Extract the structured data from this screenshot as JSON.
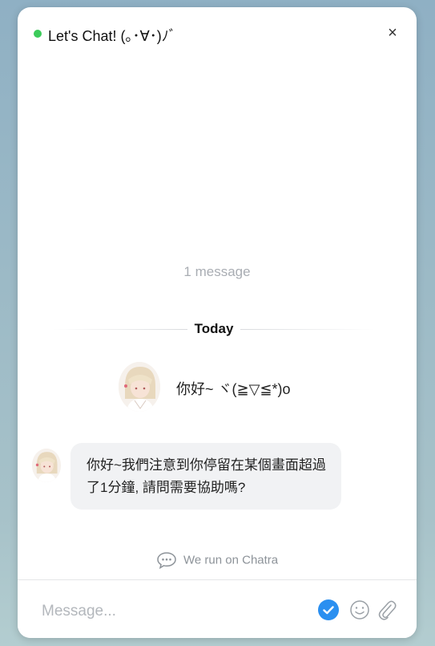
{
  "header": {
    "title": "Let's Chat! (｡･∀･)ﾉﾞ",
    "close_label": "×",
    "status_color": "#3ccb5a"
  },
  "conversation": {
    "message_count": "1 message",
    "date_divider": "Today",
    "greeting": "你好~ ヾ(≧▽≦*)o",
    "bot_message": "你好~我們注意到你停留在某個畫面超過了1分鐘, 請問需要協助嗎?"
  },
  "footer": {
    "powered_by": "We run on Chatra"
  },
  "composer": {
    "placeholder": "Message...",
    "value": "",
    "send_icon": "check-circle-icon",
    "emoji_icon": "smiley-icon",
    "attach_icon": "paperclip-icon",
    "accent_color": "#2a8ff0"
  }
}
